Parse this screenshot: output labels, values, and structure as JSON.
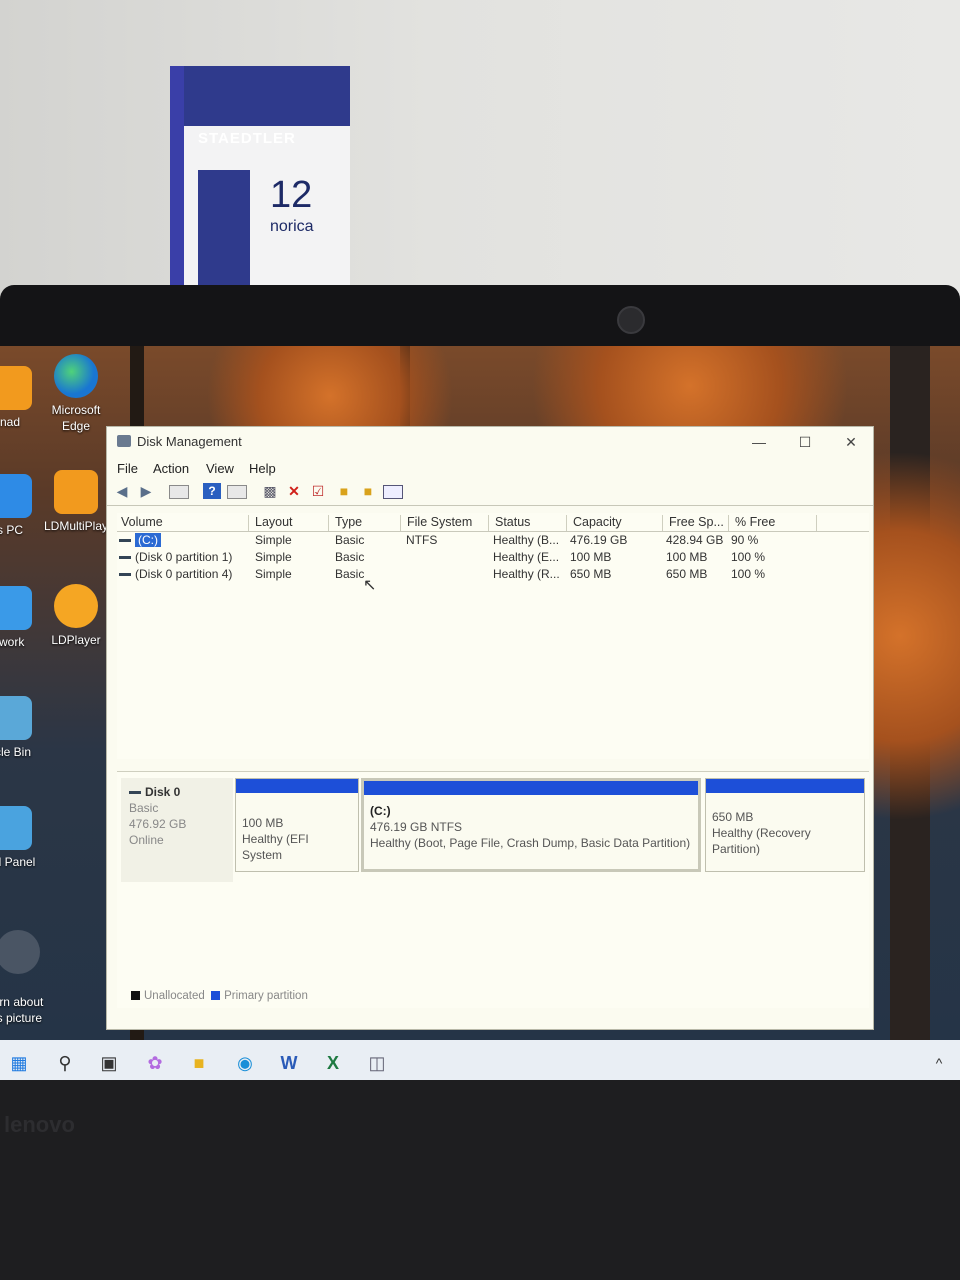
{
  "box": {
    "brand": "STAEDTLER",
    "number": "12",
    "name": "norica"
  },
  "laptop": {
    "brand": "lenovo"
  },
  "desktop": {
    "icons": [
      {
        "label": "Microsoft Edge"
      },
      {
        "label": "LDMultiPlay"
      },
      {
        "label": "LDPlayer"
      },
      {
        "label": "nad"
      },
      {
        "label": "s PC"
      },
      {
        "label": "twork"
      },
      {
        "label": "ycle Bin"
      },
      {
        "label": "trol Panel"
      },
      {
        "label": "arn about\nis picture"
      }
    ]
  },
  "window": {
    "title": "Disk Management",
    "controls": {
      "minimize": "—",
      "maximize": "☐",
      "close": "✕"
    },
    "menu": [
      "File",
      "Action",
      "View",
      "Help"
    ],
    "toolbar_icons": [
      "back-arrow-icon",
      "forward-arrow-icon",
      "properties-icon",
      "help-icon",
      "console-icon",
      "connect-icon",
      "delete-icon",
      "check-icon",
      "folder-icon",
      "folder-search-icon",
      "settings-panel-icon"
    ],
    "columns": [
      "Volume",
      "Layout",
      "Type",
      "File System",
      "Status",
      "Capacity",
      "Free Sp...",
      "% Free"
    ],
    "rows": [
      {
        "volume": "(C:)",
        "layout": "Simple",
        "type": "Basic",
        "fs": "NTFS",
        "status": "Healthy (B...",
        "capacity": "476.19 GB",
        "free": "428.94 GB",
        "pct": "90 %"
      },
      {
        "volume": "(Disk 0 partition 1)",
        "layout": "Simple",
        "type": "Basic",
        "fs": "",
        "status": "Healthy (E...",
        "capacity": "100 MB",
        "free": "100 MB",
        "pct": "100 %"
      },
      {
        "volume": "(Disk 0 partition 4)",
        "layout": "Simple",
        "type": "Basic",
        "fs": "",
        "status": "Healthy (R...",
        "capacity": "650 MB",
        "free": "650 MB",
        "pct": "100 %"
      }
    ],
    "disk": {
      "name": "Disk 0",
      "type": "Basic",
      "size": "476.92 GB",
      "state": "Online",
      "partitions": [
        {
          "title": "",
          "line1": "100 MB",
          "line2": "Healthy (EFI System"
        },
        {
          "title": "(C:)",
          "line1": "476.19 GB NTFS",
          "line2": "Healthy (Boot, Page File, Crash Dump, Basic Data Partition)"
        },
        {
          "title": "",
          "line1": "650 MB",
          "line2": "Healthy (Recovery Partition)"
        }
      ]
    },
    "legend": {
      "unallocated": "Unallocated",
      "primary": "Primary partition"
    },
    "colors": {
      "primary": "#1d4fd8",
      "unallocated": "#111111",
      "selection": "#2b6ad3"
    }
  },
  "taskbar": {
    "overflow": "^"
  }
}
